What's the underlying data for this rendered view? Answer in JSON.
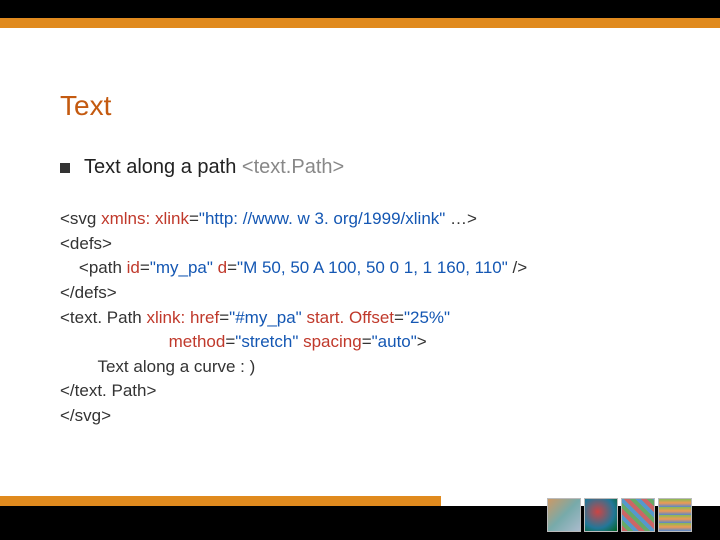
{
  "title": "Text",
  "bullet": {
    "text": "Text along a path ",
    "tag": "<text.Path>"
  },
  "code": {
    "l1a": "<svg ",
    "l1b": "xmlns: xlink",
    "l1c": "=",
    "l1d": "\"http: //www. w 3. org/1999/xlink\"",
    "l1e": " …>",
    "l2": "<defs>",
    "l3a": "    <path ",
    "l3b": "id",
    "l3c": "=",
    "l3d": "\"my_pa\"",
    "l3e": " d",
    "l3f": "=",
    "l3g": "\"M 50, 50 A 100, 50 0 1, 1 160, 110\"",
    "l3h": " />",
    "l4": "</defs>",
    "l5a": "<text. Path ",
    "l5b": "xlink: href",
    "l5c": "=",
    "l5d": "\"#my_pa\"",
    "l5e": " start. Offset",
    "l5f": "=",
    "l5g": "\"25%\"",
    "l6a": "                       ",
    "l6b": "method",
    "l6c": "=",
    "l6d": "\"stretch\"",
    "l6e": " spacing",
    "l6f": "=",
    "l6g": "\"auto\"",
    "l6h": ">",
    "l7": "        Text along a curve : )",
    "l8": "</text. Path>",
    "l9": "</svg>"
  }
}
